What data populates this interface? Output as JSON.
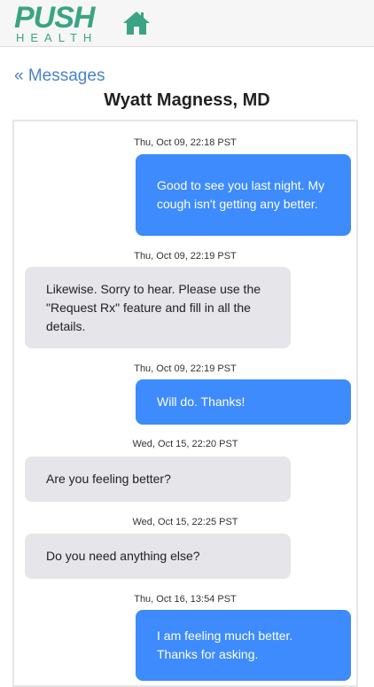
{
  "header": {
    "logo_top": "PUSH",
    "logo_bottom": "HEALTH"
  },
  "nav": {
    "back_label": "« Messages",
    "home_icon": "home-icon"
  },
  "conversation": {
    "title": "Wyatt Magness, MD",
    "messages": [
      {
        "timestamp": "Thu, Oct 09, 22:18 PST",
        "direction": "outgoing",
        "text": "Good to see you last night. My cough isn't getting any better."
      },
      {
        "timestamp": "Thu, Oct 09, 22:19 PST",
        "direction": "incoming",
        "text": "Likewise. Sorry to hear. Please use the \"Request Rx\" feature and fill in all the details."
      },
      {
        "timestamp": "Thu, Oct 09, 22:19 PST",
        "direction": "outgoing",
        "text": "Will do. Thanks!"
      },
      {
        "timestamp": "Wed, Oct 15, 22:20 PST",
        "direction": "incoming",
        "text": "Are you feeling better?"
      },
      {
        "timestamp": "Wed, Oct 15, 22:25 PST",
        "direction": "incoming",
        "text": "Do you need anything else?"
      },
      {
        "timestamp": "Thu, Oct 16, 13:54 PST",
        "direction": "outgoing",
        "text": "I am feeling much better. Thanks for asking."
      }
    ]
  },
  "colors": {
    "brand_green": "#3aa483",
    "link_blue": "#4a82c8",
    "outgoing_bubble": "#3d8bfd",
    "incoming_bubble": "#e5e5ea"
  }
}
